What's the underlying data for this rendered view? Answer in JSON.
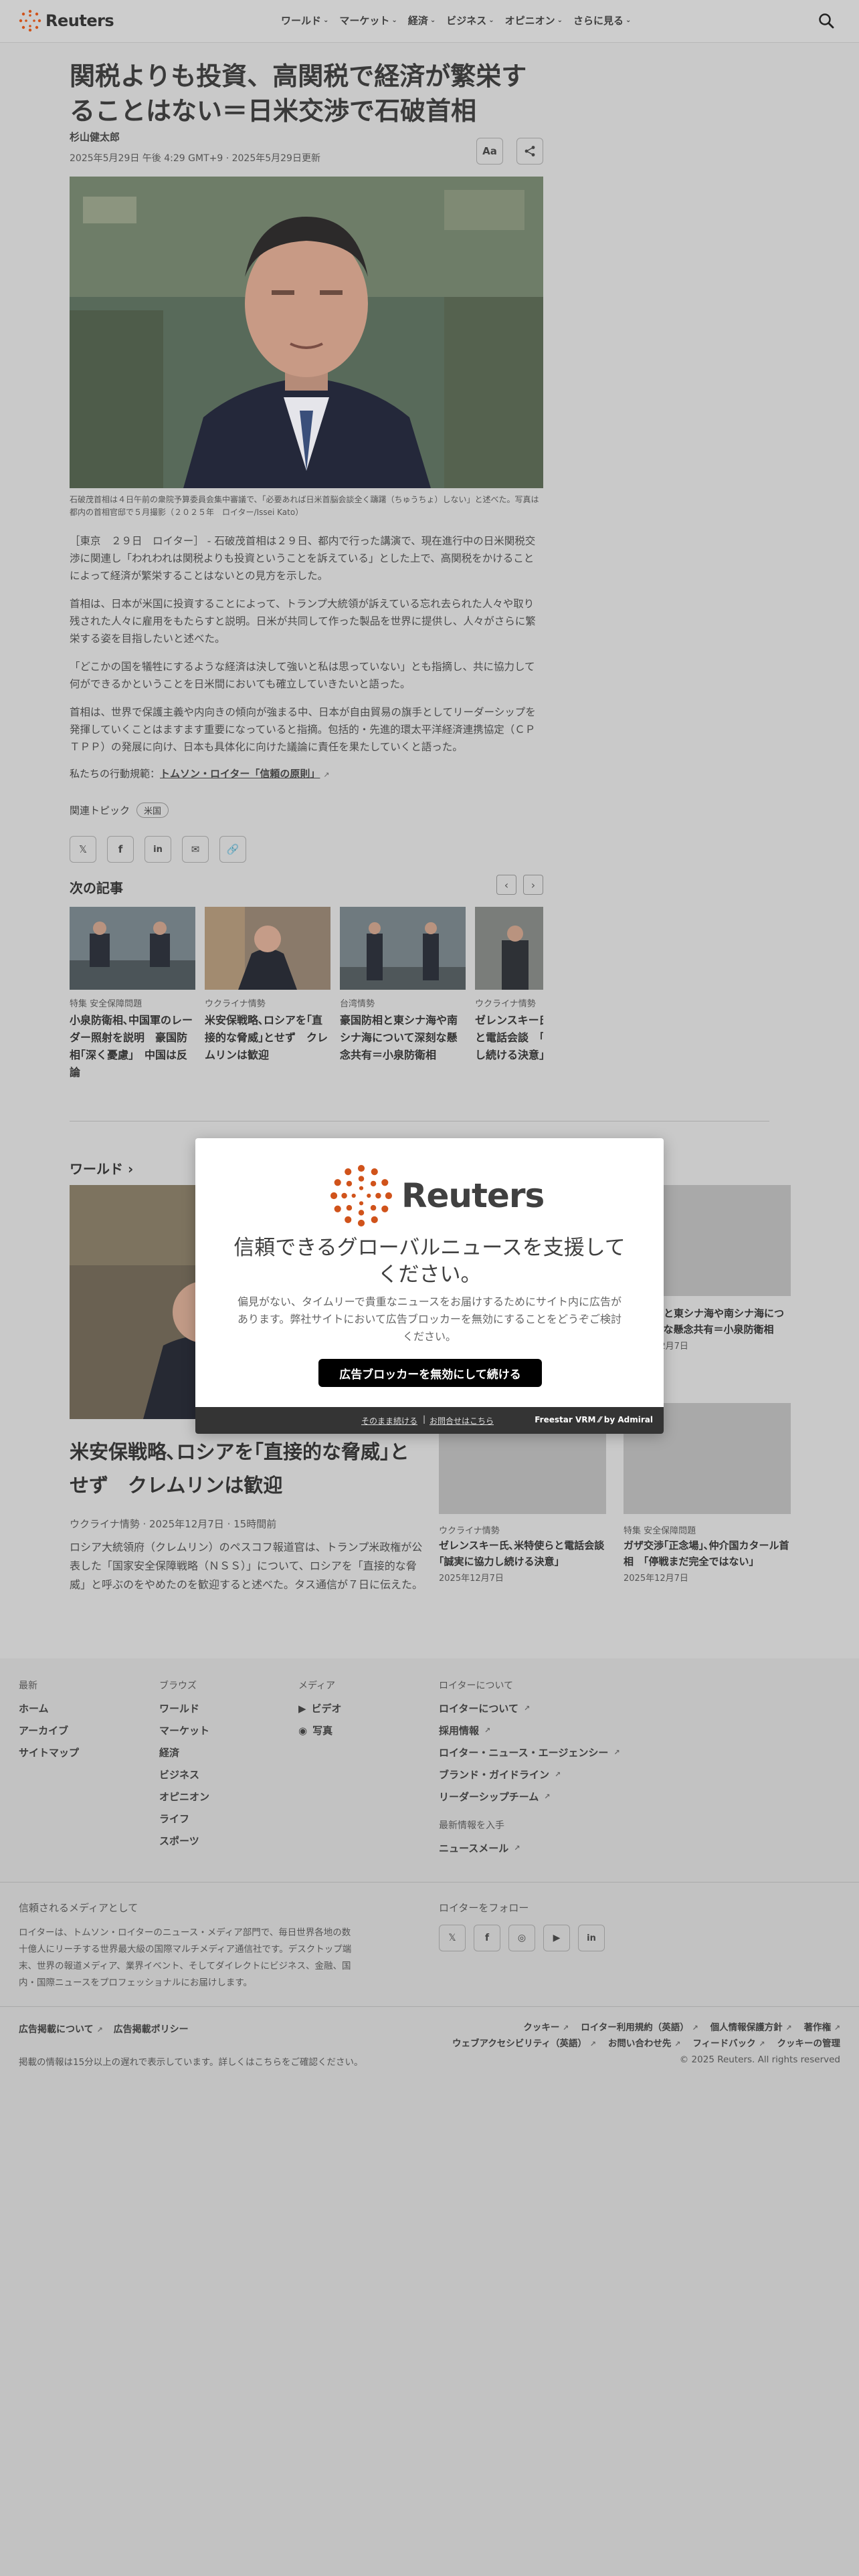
{
  "header": {
    "logo_text": "Reuters",
    "nav": [
      "ワールド",
      "マーケット",
      "経済",
      "ビジネス",
      "オピニオン",
      "さらに見る"
    ]
  },
  "article": {
    "headline": "関税よりも投資、高関税で経済が繁栄することはない＝日米交渉で石破首相",
    "author": "杉山健太郎",
    "date": "2025年5月29日 午後 4:29 GMT+9 · 2025年5月29日更新",
    "text_size_label": "Aa",
    "caption": "石破茂首相は４日午前の衆院予算委員会集中審議で、「必要あれば日米首脳会談全く躊躇（ちゅうちょ）しない」と述べた。写真は都内の首相官邸で５月撮影（２０２５年　ロイター/Issei Kato）",
    "paragraphs": [
      "［東京　２９日　ロイター］ - 石破茂首相は２９日、都内で行った講演で、現在進行中の日米関税交渉に関連し「われわれは関税よりも投資ということを訴えている」とした上で、高関税をかけることによって経済が繁栄することはないとの見方を示した。",
      "首相は、日本が米国に投資することによって、トランプ大統領が訴えている忘れ去られた人々や取り残された人々に雇用をもたらすと説明。日米が共同して作った製品を世界に提供し、人々がさらに繁栄する姿を目指したいと述べた。",
      "「どこかの国を犠牲にするような経済は決して強いと私は思っていない」とも指摘し、共に協力して何ができるかということを日米間においても確立していきたいと語った。",
      "首相は、世界で保護主義や内向きの傾向が強まる中、日本が自由貿易の旗手としてリーダーシップを発揮していくことはますます重要になっていると指摘。包括的・先進的環太平洋経済連携協定（ＣＰＴＰＰ）の発展に向け、日本も具体化に向けた議論に責任を果たしていくと語った。"
    ],
    "trust_prefix": "私たちの行動規範：",
    "trust_link": "トムソン・ロイター「信頼の原則」",
    "topics_label": "関連トピック",
    "topic": "米国"
  },
  "next": {
    "title": "次の記事",
    "cards": [
      {
        "category": "特集 安全保障問題",
        "title": "小泉防衛相､中国軍のレーダー照射を説明　豪国防相｢深く憂慮｣　中国は反論"
      },
      {
        "category": "ウクライナ情勢",
        "title": "米安保戦略､ロシアを｢直接的な脅威｣とせず　クレムリンは歓迎"
      },
      {
        "category": "台湾情勢",
        "title": "豪国防相と東シナ海や南シナ海について深刻な懸念共有＝小泉防衛相"
      },
      {
        "category": "ウクライナ情勢",
        "title": "ゼレンスキー氏､米特使らと電話会談　｢誠実に協力し続ける決意｣"
      }
    ]
  },
  "world": {
    "title": "ワールド",
    "lead": {
      "title": "米安保戦略､ロシアを｢直接的な脅威｣とせず　クレムリンは歓迎",
      "meta": "ウクライナ情勢 · 2025年12月7日 · 15時間前",
      "desc": "ロシア大統領府（クレムリン）のペスコフ報道官は、トランプ米政権が公表した「国家安全保障戦略（ＮＳＳ）」について、ロシアを「直接的な脅威」と呼ぶのをやめたのを歓迎すると述べた。タス通信が７日に伝えた。"
    },
    "side": [
      {
        "category": "",
        "title": "豪国防相と東シナ海や南シナ海について深刻な懸念共有＝小泉防衛相",
        "date": "2025年12月7日"
      },
      {
        "category": "ウクライナ情勢",
        "title": "ゼレンスキー氏､米特使らと電話会談　｢誠実に協力し続ける決意｣",
        "date": "2025年12月7日"
      },
      {
        "category": "特集 安全保障問題",
        "title": "ガザ交渉｢正念場｣､仲介国カタール首相　｢停戦まだ完全ではない｣",
        "date": "2025年12月7日"
      }
    ]
  },
  "modal": {
    "logo_text": "Reuters",
    "title": "信頼できるグローバルニュースを支援してください。",
    "desc": "偏見がない、タイムリーで貴重なニュースをお届けするためにサイト内に広告があります。弊社サイトにおいて広告ブロッカーを無効にすることをどうぞご検討ください。",
    "button": "広告ブロッカーを無効にして続ける",
    "continue_link": "そのまま続ける",
    "contact_link": "お問合せはこちら",
    "brand": "Freestar VRM ⁄⁄ by Admiral"
  },
  "footer": {
    "latest": {
      "head": "最新",
      "links": [
        "ホーム",
        "アーカイブ",
        "サイトマップ"
      ]
    },
    "browse": {
      "head": "ブラウズ",
      "links": [
        "ワールド",
        "マーケット",
        "経済",
        "ビジネス",
        "オピニオン",
        "ライフ",
        "スポーツ"
      ]
    },
    "media": {
      "head": "メディア",
      "links": [
        "ビデオ",
        "写真"
      ]
    },
    "about": {
      "head": "ロイターについて",
      "links": [
        "ロイターについて",
        "採用情報",
        "ロイター・ニュース・エージェンシー",
        "ブランド・ガイドライン",
        "リーダーシップチーム"
      ]
    },
    "latest_info": {
      "head": "最新情報を入手",
      "link": "ニュースメール"
    },
    "trusted_head": "信頼されるメディアとして",
    "trusted_p": "ロイターは、トムソン・ロイターのニュース・メディア部門で、毎日世界各地の数十億人にリーチする世界最大級の国際マルチメディア通信社です。デスクトップ端末、世界の報道メディア、業界イベント、そしてダイレクトにビジネス、金融、国内・国際ニュースをプロフェッショナルにお届けします。",
    "follow_head": "ロイターをフォロー",
    "legal_left": [
      "広告掲載について",
      "広告掲載ポリシー"
    ],
    "legal_right": [
      "クッキー",
      "ロイター利用規約（英語）",
      "個人情報保護方針",
      "著作権",
      "ウェブアクセシビリティ（英語）",
      "お問い合わせ先",
      "フィードバック",
      "クッキーの管理"
    ],
    "delay": "掲載の情報は15分以上の遅れで表示しています。詳しくはこちらをご確認ください。",
    "copyright": "© 2025 Reuters. All rights reserved"
  },
  "colors": {
    "brand_orange": "#d0531b",
    "overlay_bg": "#c9c9c9",
    "modal_bar": "#343434",
    "button": "#000000"
  },
  "icons": [
    "reuters-logo-icon",
    "search-icon",
    "chevron-down-icon",
    "text-size-icon",
    "share-icon",
    "x-icon",
    "facebook-icon",
    "linkedin-icon",
    "email-icon",
    "link-icon",
    "chevron-left-icon",
    "chevron-right-icon",
    "video-icon",
    "camera-icon",
    "external-link-icon",
    "instagram-icon",
    "youtube-icon"
  ]
}
